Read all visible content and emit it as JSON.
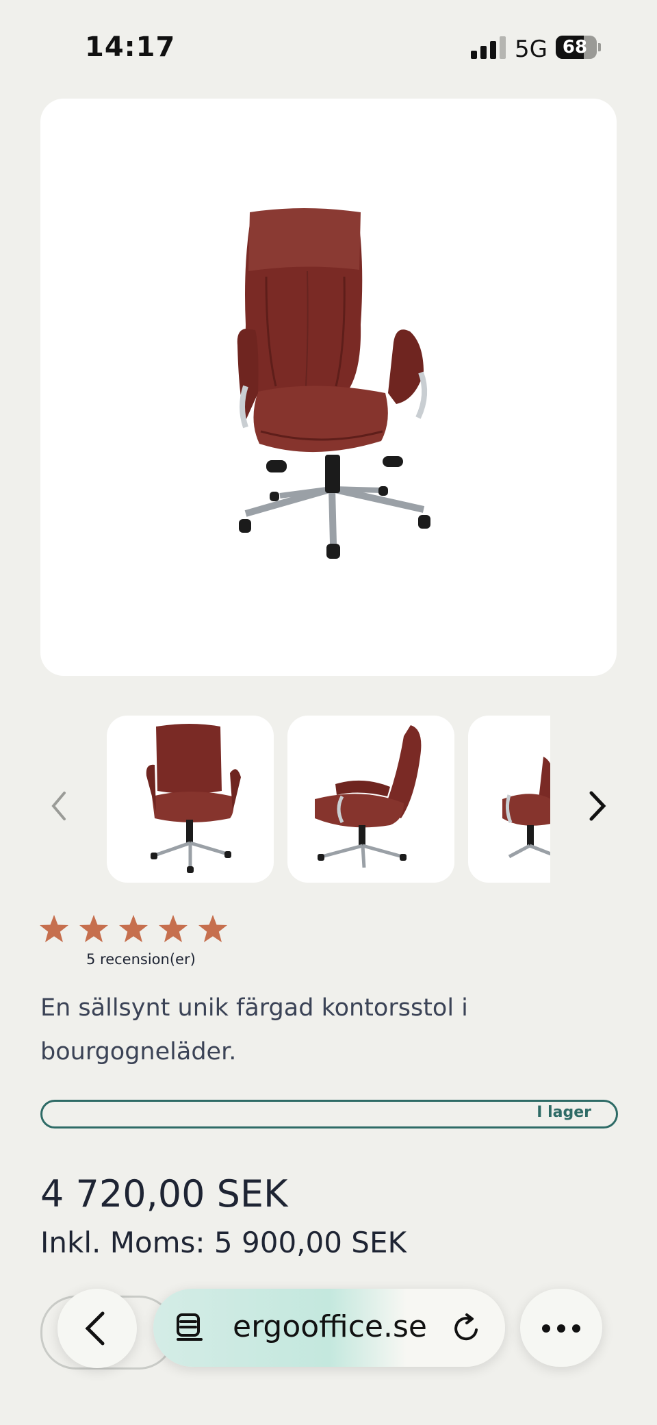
{
  "status_bar": {
    "time": "14:17",
    "network": "5G",
    "battery": "68",
    "battery_level": 0.68
  },
  "product": {
    "rating": 5,
    "review_count": "5 recension(er)",
    "description": "En sällsynt unik färgad kontorsstol i bourgogneläder.",
    "stock": "I lager",
    "price": "4 720,00 SEK",
    "price_incl_vat": "Inkl. Moms: 5 900,00 SEK"
  },
  "gallery": {
    "thumbnails": [
      "front",
      "side",
      "three-quarter"
    ]
  },
  "browser": {
    "url": "ergooffice.se"
  },
  "colors": {
    "accent_teal": "#2e6b66",
    "star": "#c66f4e",
    "leather": "#7a2a25"
  }
}
